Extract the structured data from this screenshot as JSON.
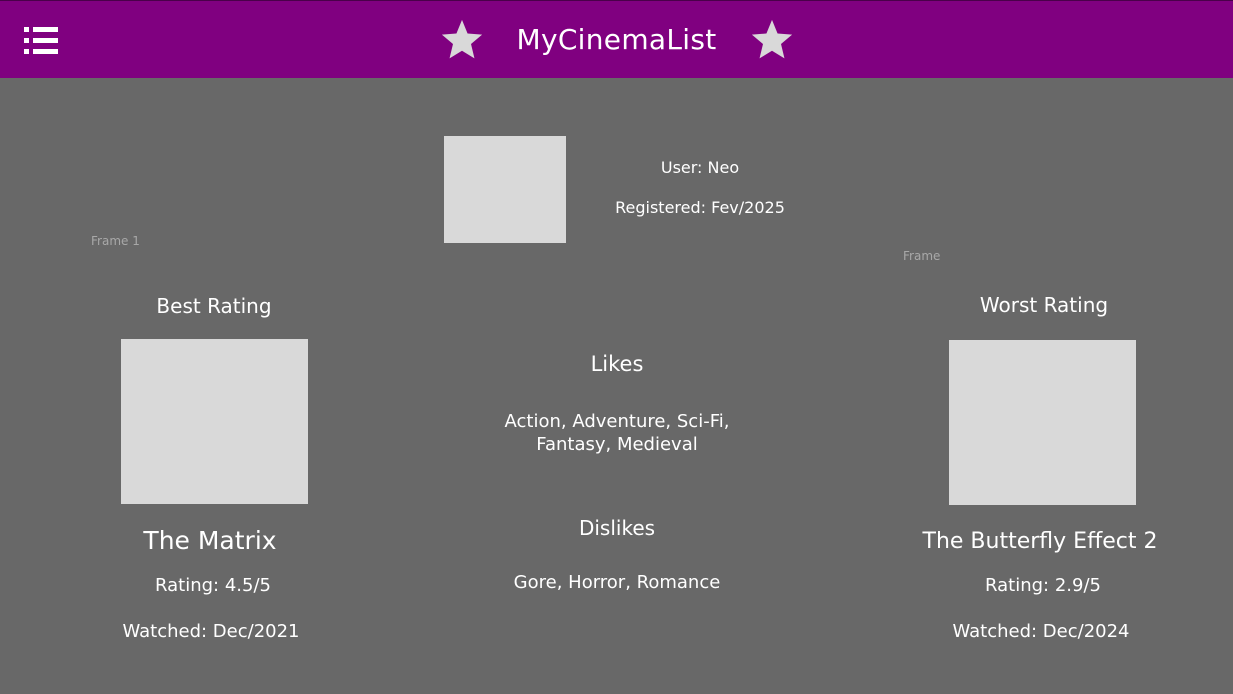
{
  "header": {
    "title": "MyCinemaList",
    "menu_icon": "menu-list-icon",
    "star_icon": "star-icon",
    "background_color": "#800080"
  },
  "profile": {
    "user": "User: Neo",
    "registered": "Registered: Fev/2025"
  },
  "frames": {
    "left_label": "Frame 1",
    "right_label": "Frame"
  },
  "best": {
    "title": "Best Rating",
    "movie": "The Matrix",
    "rating": "Rating: 4.5/5",
    "watched": "Watched: Dec/2021"
  },
  "worst": {
    "title": "Worst Rating",
    "movie": "The Butterfly Effect 2",
    "rating": "Rating: 2.9/5",
    "watched": "Watched: Dec/2024"
  },
  "likes": {
    "title": "Likes",
    "line1": "Action, Adventure, Sci-Fi,",
    "line2": "Fantasy, Medieval"
  },
  "dislikes": {
    "title": "Dislikes",
    "text": "Gore, Horror, Romance"
  }
}
